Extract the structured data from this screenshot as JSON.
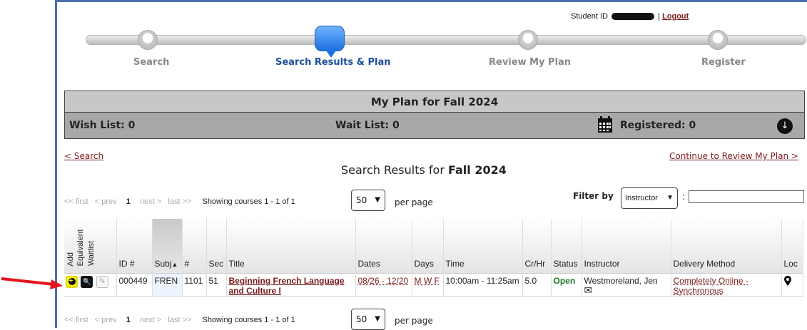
{
  "header": {
    "student_id_label": "Student ID",
    "separator": "|",
    "logout": "Logout"
  },
  "steps": [
    {
      "label": "Search"
    },
    {
      "label": "Search Results & Plan"
    },
    {
      "label": "Review My Plan"
    },
    {
      "label": "Register"
    }
  ],
  "plan": {
    "title": "My Plan for Fall 2024",
    "wish_list": "Wish List: 0",
    "wait_list": "Wait List: 0",
    "registered": "Registered: 0",
    "down_icon": "↓"
  },
  "nav": {
    "back_search": "< Search",
    "continue": "Continue to Review My Plan >"
  },
  "results": {
    "title_prefix": "Search Results for",
    "term": "Fall 2024"
  },
  "pager": {
    "first": "<< first",
    "prev": "< prev",
    "current": "1",
    "next": "next >",
    "last": "last >>",
    "showing": "Showing courses 1 - 1 of 1",
    "per_page_value": "50",
    "per_page_label": "per page"
  },
  "filter": {
    "label": "Filter by",
    "selected": "Instructor",
    "colon": ":",
    "value": ""
  },
  "table": {
    "headers": {
      "add": "Add",
      "equivalent": "Equivalent",
      "waitlist": "Waitlist",
      "id": "ID #",
      "subj": "Subj",
      "sort_arrow": "▲",
      "num": "#",
      "sec": "Sec",
      "title": "Title",
      "dates": "Dates",
      "days": "Days",
      "time": "Time",
      "crhr": "Cr/Hr",
      "status": "Status",
      "instructor": "Instructor",
      "delivery": "Delivery Method",
      "loc": "Loc"
    },
    "rows": [
      {
        "id": "000449",
        "subj": "FREN",
        "num": "1101",
        "sec": "51",
        "title_line1": "Beginning French Language",
        "title_line2": "and Culture I",
        "dates": "08/26 - 12/20",
        "days": "M W F",
        "time": "10:00am - 11:25am",
        "crhr": "5.0",
        "status": "Open",
        "instructor": "Westmoreland, Jen",
        "delivery_line1": "Completely Online -",
        "delivery_line2": "Synchronous",
        "loc_icon": "⌕"
      }
    ]
  },
  "icons": {
    "search_icon": "🔍",
    "edit_icon": "✎",
    "mail_icon": "✉",
    "pin_icon": "▼",
    "chevron": "⌄"
  },
  "colors": {
    "link": "#7a1b1b",
    "active_step": "#1d4f9c",
    "open_status": "#1b7a2a",
    "annotation_arrow": "#e5141b"
  }
}
